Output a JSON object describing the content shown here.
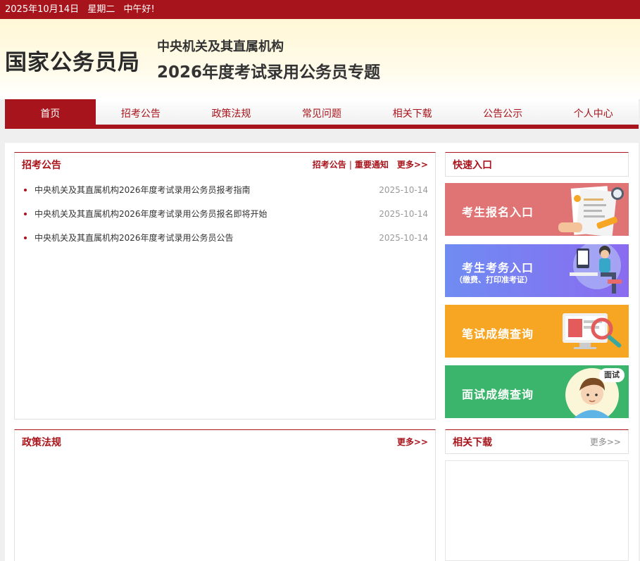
{
  "topbar": {
    "date": "2025年10月14日",
    "weekday": "星期二",
    "greeting": "中午好!"
  },
  "header": {
    "org_name": "国家公务员局",
    "subtitle_line1": "中央机关及其直属机构",
    "subtitle_line2": "2026年度考试录用公务员专题"
  },
  "nav": {
    "items": [
      {
        "label": "首页",
        "active": true
      },
      {
        "label": "招考公告"
      },
      {
        "label": "政策法规"
      },
      {
        "label": "常见问题"
      },
      {
        "label": "相关下载"
      },
      {
        "label": "公告公示"
      },
      {
        "label": "个人中心"
      }
    ]
  },
  "announcements": {
    "title": "招考公告",
    "tab1": "招考公告",
    "separator": "|",
    "tab2": "重要通知",
    "more": "更多>>",
    "items": [
      {
        "title": "中央机关及其直属机构2026年度考试录用公务员报考指南",
        "date": "2025-10-14"
      },
      {
        "title": "中央机关及其直属机构2026年度考试录用公务员报名即将开始",
        "date": "2025-10-14"
      },
      {
        "title": "中央机关及其直属机构2026年度考试录用公务员公告",
        "date": "2025-10-14"
      }
    ]
  },
  "quick": {
    "title": "快速入口",
    "cards": [
      {
        "label": "考生报名入口",
        "color": "#e07373"
      },
      {
        "label": "考生考务入口",
        "sub": "（缴费、打印准考证）",
        "color": "#6f82f2"
      },
      {
        "label": "笔试成绩查询",
        "color": "#f6a623"
      },
      {
        "label": "面试成绩查询",
        "badge": "面试",
        "color": "#3cb56c"
      }
    ]
  },
  "policy": {
    "title": "政策法规",
    "more": "更多>>"
  },
  "downloads": {
    "title": "相关下载",
    "more": "更多>>"
  },
  "colors": {
    "brand_red": "#a8141b",
    "header_bg": "#fff7d6",
    "page_bg": "#efefef"
  }
}
